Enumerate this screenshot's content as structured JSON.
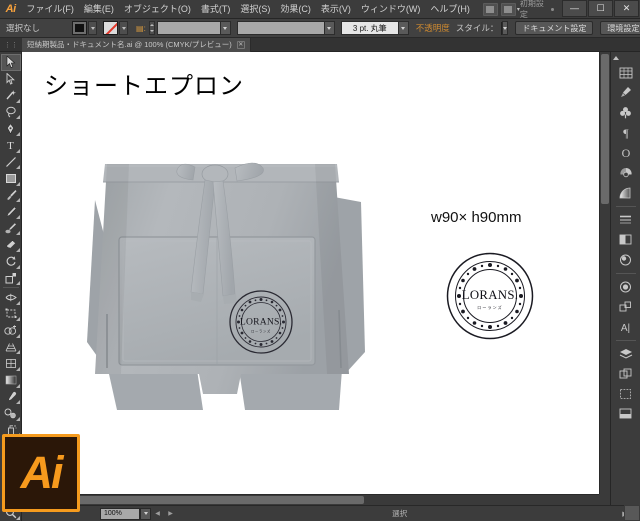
{
  "app": {
    "logo": "Ai",
    "workspace": "初期設定",
    "window_controls": {
      "minimize": "—",
      "maximize": "☐",
      "close": "✕"
    }
  },
  "menu": {
    "items": [
      {
        "label": "ファイル(F)",
        "name": "menu-file"
      },
      {
        "label": "編集(E)",
        "name": "menu-edit"
      },
      {
        "label": "オブジェクト(O)",
        "name": "menu-object"
      },
      {
        "label": "書式(T)",
        "name": "menu-type"
      },
      {
        "label": "選択(S)",
        "name": "menu-select"
      },
      {
        "label": "効果(C)",
        "name": "menu-effect"
      },
      {
        "label": "表示(V)",
        "name": "menu-view"
      },
      {
        "label": "ウィンドウ(W)",
        "name": "menu-window"
      },
      {
        "label": "ヘルプ(H)",
        "name": "menu-help"
      }
    ]
  },
  "control_bar": {
    "selection_label": "選択なし",
    "fill_color": "#111111",
    "stroke_color": "none",
    "stroke_weight": "",
    "stroke_profile": "3 pt. 丸筆",
    "variable_width": "",
    "opacity_label": "不透明度",
    "style_label": "スタイル：",
    "document_setup": "ドキュメント設定",
    "preferences": "環境設定"
  },
  "document_tab": {
    "name": "短納期製品・ドキュメント名.ai @ 100% (CMYK/プレビュー)",
    "close": "✕"
  },
  "tools": [
    {
      "name": "tool-selection",
      "icon": "arrow-solid-icon",
      "selected": true
    },
    {
      "name": "tool-direct-selection",
      "icon": "arrow-outline-icon",
      "selected": false
    },
    {
      "name": "tool-magic-wand",
      "icon": "magic-wand-icon",
      "selected": false
    },
    {
      "name": "tool-lasso",
      "icon": "lasso-icon",
      "selected": false
    },
    {
      "name": "tool-pen",
      "icon": "pen-icon",
      "selected": false
    },
    {
      "name": "tool-type",
      "icon": "type-icon",
      "selected": false
    },
    {
      "name": "tool-line-segment",
      "icon": "line-icon",
      "selected": false
    },
    {
      "name": "tool-rectangle",
      "icon": "rectangle-icon",
      "selected": false
    },
    {
      "name": "tool-paintbrush",
      "icon": "paintbrush-icon",
      "selected": false
    },
    {
      "name": "tool-pencil",
      "icon": "pencil-icon",
      "selected": false
    },
    {
      "name": "tool-blob-brush",
      "icon": "blob-brush-icon",
      "selected": false
    },
    {
      "name": "tool-eraser",
      "icon": "eraser-icon",
      "selected": false
    },
    {
      "name": "tool-rotate",
      "icon": "rotate-icon",
      "selected": false
    },
    {
      "name": "tool-scale",
      "icon": "scale-icon",
      "selected": false
    },
    {
      "name": "tool-width",
      "icon": "width-icon",
      "selected": false
    },
    {
      "name": "tool-free-transform",
      "icon": "free-transform-icon",
      "selected": false
    },
    {
      "name": "tool-shape-builder",
      "icon": "shape-builder-icon",
      "selected": false
    },
    {
      "name": "tool-perspective-grid",
      "icon": "perspective-grid-icon",
      "selected": false
    },
    {
      "name": "tool-mesh",
      "icon": "mesh-icon",
      "selected": false
    },
    {
      "name": "tool-gradient",
      "icon": "gradient-icon",
      "selected": false
    },
    {
      "name": "tool-eyedropper",
      "icon": "eyedropper-icon",
      "selected": false
    },
    {
      "name": "tool-blend",
      "icon": "blend-icon",
      "selected": false
    },
    {
      "name": "tool-symbol-sprayer",
      "icon": "symbol-sprayer-icon",
      "selected": false
    },
    {
      "name": "tool-column-graph",
      "icon": "bar-graph-icon",
      "selected": false
    },
    {
      "name": "tool-artboard",
      "icon": "artboard-icon",
      "selected": false
    },
    {
      "name": "tool-slice",
      "icon": "slice-knife-icon",
      "selected": false
    },
    {
      "name": "tool-hand",
      "icon": "hand-icon",
      "selected": false
    },
    {
      "name": "tool-zoom",
      "icon": "magnifier-icon",
      "selected": false
    }
  ],
  "panels": [
    {
      "name": "panel-swatches",
      "icon": "swatches-grid-icon"
    },
    {
      "name": "panel-brushes",
      "icon": "brush-icon"
    },
    {
      "name": "panel-symbols",
      "icon": "clover-icon"
    },
    {
      "name": "panel-paragraph",
      "icon": "pilcrow-icon"
    },
    {
      "name": "panel-character",
      "icon": "letter-o-icon"
    },
    {
      "name": "panel-color-guide",
      "icon": "color-wheel-icon"
    },
    {
      "name": "panel-gradient",
      "icon": "gradient-fan-icon"
    },
    {
      "name": "panel-stroke",
      "icon": "stroke-lines-icon"
    },
    {
      "name": "panel-transparency",
      "icon": "transparency-square-icon"
    },
    {
      "name": "panel-appearance",
      "icon": "appearance-circle-icon"
    },
    {
      "name": "panel-graphic-styles",
      "icon": "graphic-styles-icon"
    },
    {
      "name": "panel-transform",
      "icon": "transform-icon"
    },
    {
      "name": "panel-align",
      "icon": "align-ai-icon"
    },
    {
      "name": "panel-layers",
      "icon": "layers-stack-icon"
    },
    {
      "name": "panel-artboards",
      "icon": "artboards-icon"
    },
    {
      "name": "panel-separations",
      "icon": "separations-icon"
    },
    {
      "name": "panel-links",
      "icon": "links-icon"
    }
  ],
  "artwork": {
    "title": "ショートエプロン",
    "dimensions": "w90× h90mm",
    "product_color": "#a8acb0",
    "stamp": {
      "brand": "LORANS.",
      "subtitle": "ローランズ"
    },
    "apron_stamp": {
      "brand": "LORANS.",
      "subtitle": "ローランズ"
    }
  },
  "status_bar": {
    "zoom_level": "100%",
    "status_text": "選択",
    "first_page": "◀",
    "last_page": "▶"
  }
}
